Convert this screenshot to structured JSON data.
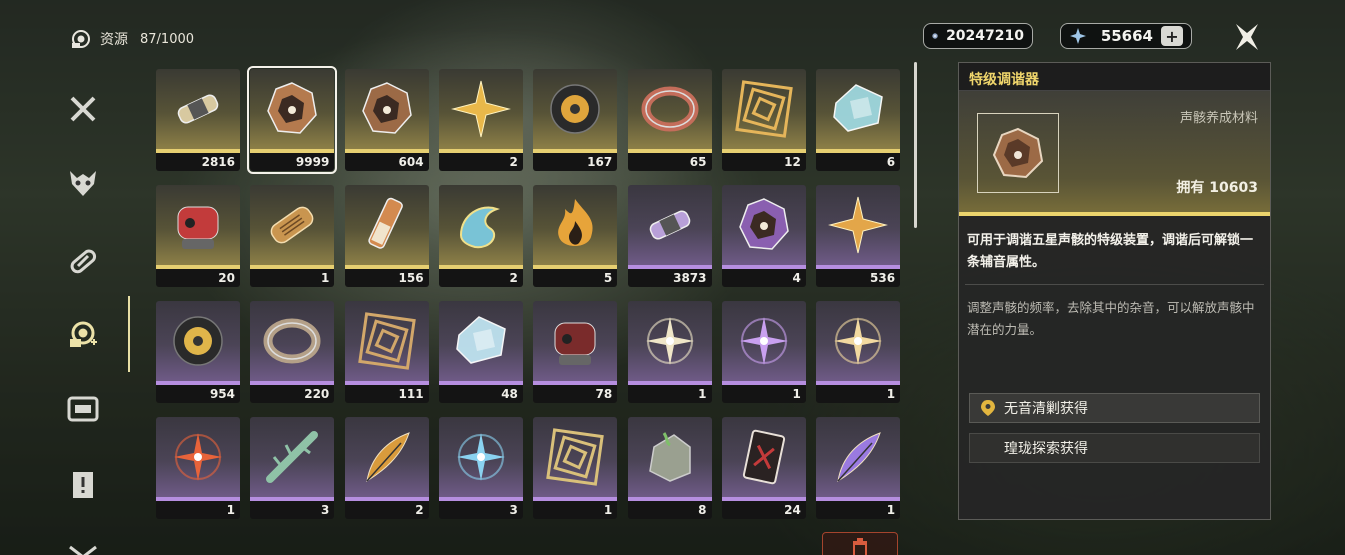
{
  "header": {
    "title": "资源",
    "capacity": "87/1000",
    "icon": "resource-icon"
  },
  "currency": {
    "coin_value": "20247210",
    "coin_icon": "shell-credit-icon",
    "star_value": "55664",
    "star_icon": "astrite-star-icon",
    "add_label": "+"
  },
  "sidebar": {
    "items": [
      {
        "icon": "crossed-swords-icon",
        "active": false
      },
      {
        "icon": "echo-mask-icon",
        "active": false
      },
      {
        "icon": "pill-capsule-icon",
        "active": false
      },
      {
        "icon": "resource-icon",
        "active": true
      },
      {
        "icon": "supply-box-icon",
        "active": false
      },
      {
        "icon": "quest-item-icon",
        "active": false
      },
      {
        "icon": "envelope-icon",
        "active": false
      }
    ]
  },
  "items": [
    {
      "qty": "2816",
      "rarity": "gold",
      "icon": "canister-icon",
      "color": "#d8c9a0"
    },
    {
      "qty": "9999",
      "rarity": "gold",
      "icon": "tuner-icon",
      "color": "#b47a4e",
      "selected": true
    },
    {
      "qty": "604",
      "rarity": "gold",
      "icon": "tuner-icon",
      "color": "#9c6a46"
    },
    {
      "qty": "2",
      "rarity": "gold",
      "icon": "star-shard-icon",
      "color": "#e9b84a"
    },
    {
      "qty": "167",
      "rarity": "gold",
      "icon": "orb-icon",
      "color": "#e0a53c"
    },
    {
      "qty": "65",
      "rarity": "gold",
      "icon": "ring-icon",
      "color": "#c46d5a"
    },
    {
      "qty": "12",
      "rarity": "gold",
      "icon": "spiral-icon",
      "color": "#e5b55a"
    },
    {
      "qty": "6",
      "rarity": "gold",
      "icon": "crystal-icon",
      "color": "#9fd7df"
    },
    {
      "qty": "20",
      "rarity": "gold",
      "icon": "mask-icon",
      "color": "#c23b3b"
    },
    {
      "qty": "1",
      "rarity": "gold",
      "icon": "scroll-icon",
      "color": "#c9954f"
    },
    {
      "qty": "156",
      "rarity": "gold",
      "icon": "vial-icon",
      "color": "#d38a4f"
    },
    {
      "qty": "2",
      "rarity": "gold",
      "icon": "flame-swirl-icon",
      "color": "#79c3d6"
    },
    {
      "qty": "5",
      "rarity": "gold",
      "icon": "fire-icon",
      "color": "#e7a43a"
    },
    {
      "qty": "3873",
      "rarity": "purple",
      "icon": "canister-icon",
      "color": "#b8a0d8"
    },
    {
      "qty": "4",
      "rarity": "purple",
      "icon": "tuner-icon",
      "color": "#8a5fb0"
    },
    {
      "qty": "536",
      "rarity": "purple",
      "icon": "star-shard-icon",
      "color": "#e3a649"
    },
    {
      "qty": "954",
      "rarity": "purple",
      "icon": "orb-icon",
      "color": "#e0b54a"
    },
    {
      "qty": "220",
      "rarity": "purple",
      "icon": "ring-icon",
      "color": "#b4a088"
    },
    {
      "qty": "111",
      "rarity": "purple",
      "icon": "spiral-icon",
      "color": "#d2a76a"
    },
    {
      "qty": "48",
      "rarity": "purple",
      "icon": "crystal-icon",
      "color": "#bfe3f0"
    },
    {
      "qty": "78",
      "rarity": "purple",
      "icon": "mask-icon",
      "color": "#7a2b2b"
    },
    {
      "qty": "1",
      "rarity": "purple",
      "icon": "spark-icon",
      "color": "#efe6c8"
    },
    {
      "qty": "1",
      "rarity": "purple",
      "icon": "spark-icon",
      "color": "#c9a0f0"
    },
    {
      "qty": "1",
      "rarity": "purple",
      "icon": "spark-icon",
      "color": "#f2d9a0"
    },
    {
      "qty": "1",
      "rarity": "purple",
      "icon": "spark-icon",
      "color": "#e8633a"
    },
    {
      "qty": "3",
      "rarity": "purple",
      "icon": "branch-icon",
      "color": "#8fc2a7"
    },
    {
      "qty": "2",
      "rarity": "purple",
      "icon": "feather-icon",
      "color": "#d99b3c"
    },
    {
      "qty": "3",
      "rarity": "purple",
      "icon": "spark-icon",
      "color": "#8ad2f0"
    },
    {
      "qty": "1",
      "rarity": "purple",
      "icon": "spiral-icon",
      "color": "#d9c07a"
    },
    {
      "qty": "8",
      "rarity": "purple",
      "icon": "stone-icon",
      "color": "#9aa090"
    },
    {
      "qty": "24",
      "rarity": "purple",
      "icon": "card-icon",
      "color": "#c43a3a"
    },
    {
      "qty": "1",
      "rarity": "purple",
      "icon": "feather-icon",
      "color": "#9a7ae0"
    }
  ],
  "detail": {
    "name": "特级调谐器",
    "category": "声骸养成材料",
    "owned": "拥有 10603",
    "description": "可用于调谐五星声骸的特级装置，调谐后可解锁一条辅音属性。",
    "flavor": "调整声骸的频率，去除其中的杂音，可以解放声骸中潜在的力量。",
    "sources": [
      {
        "label": "无音清剿获得",
        "icon": "location-pin-icon"
      },
      {
        "label": "瑝珑探索获得",
        "icon": ""
      }
    ]
  },
  "colors": {
    "gold": "#e6cf71",
    "purple": "#b68ee0",
    "title": "#f0d66c"
  }
}
